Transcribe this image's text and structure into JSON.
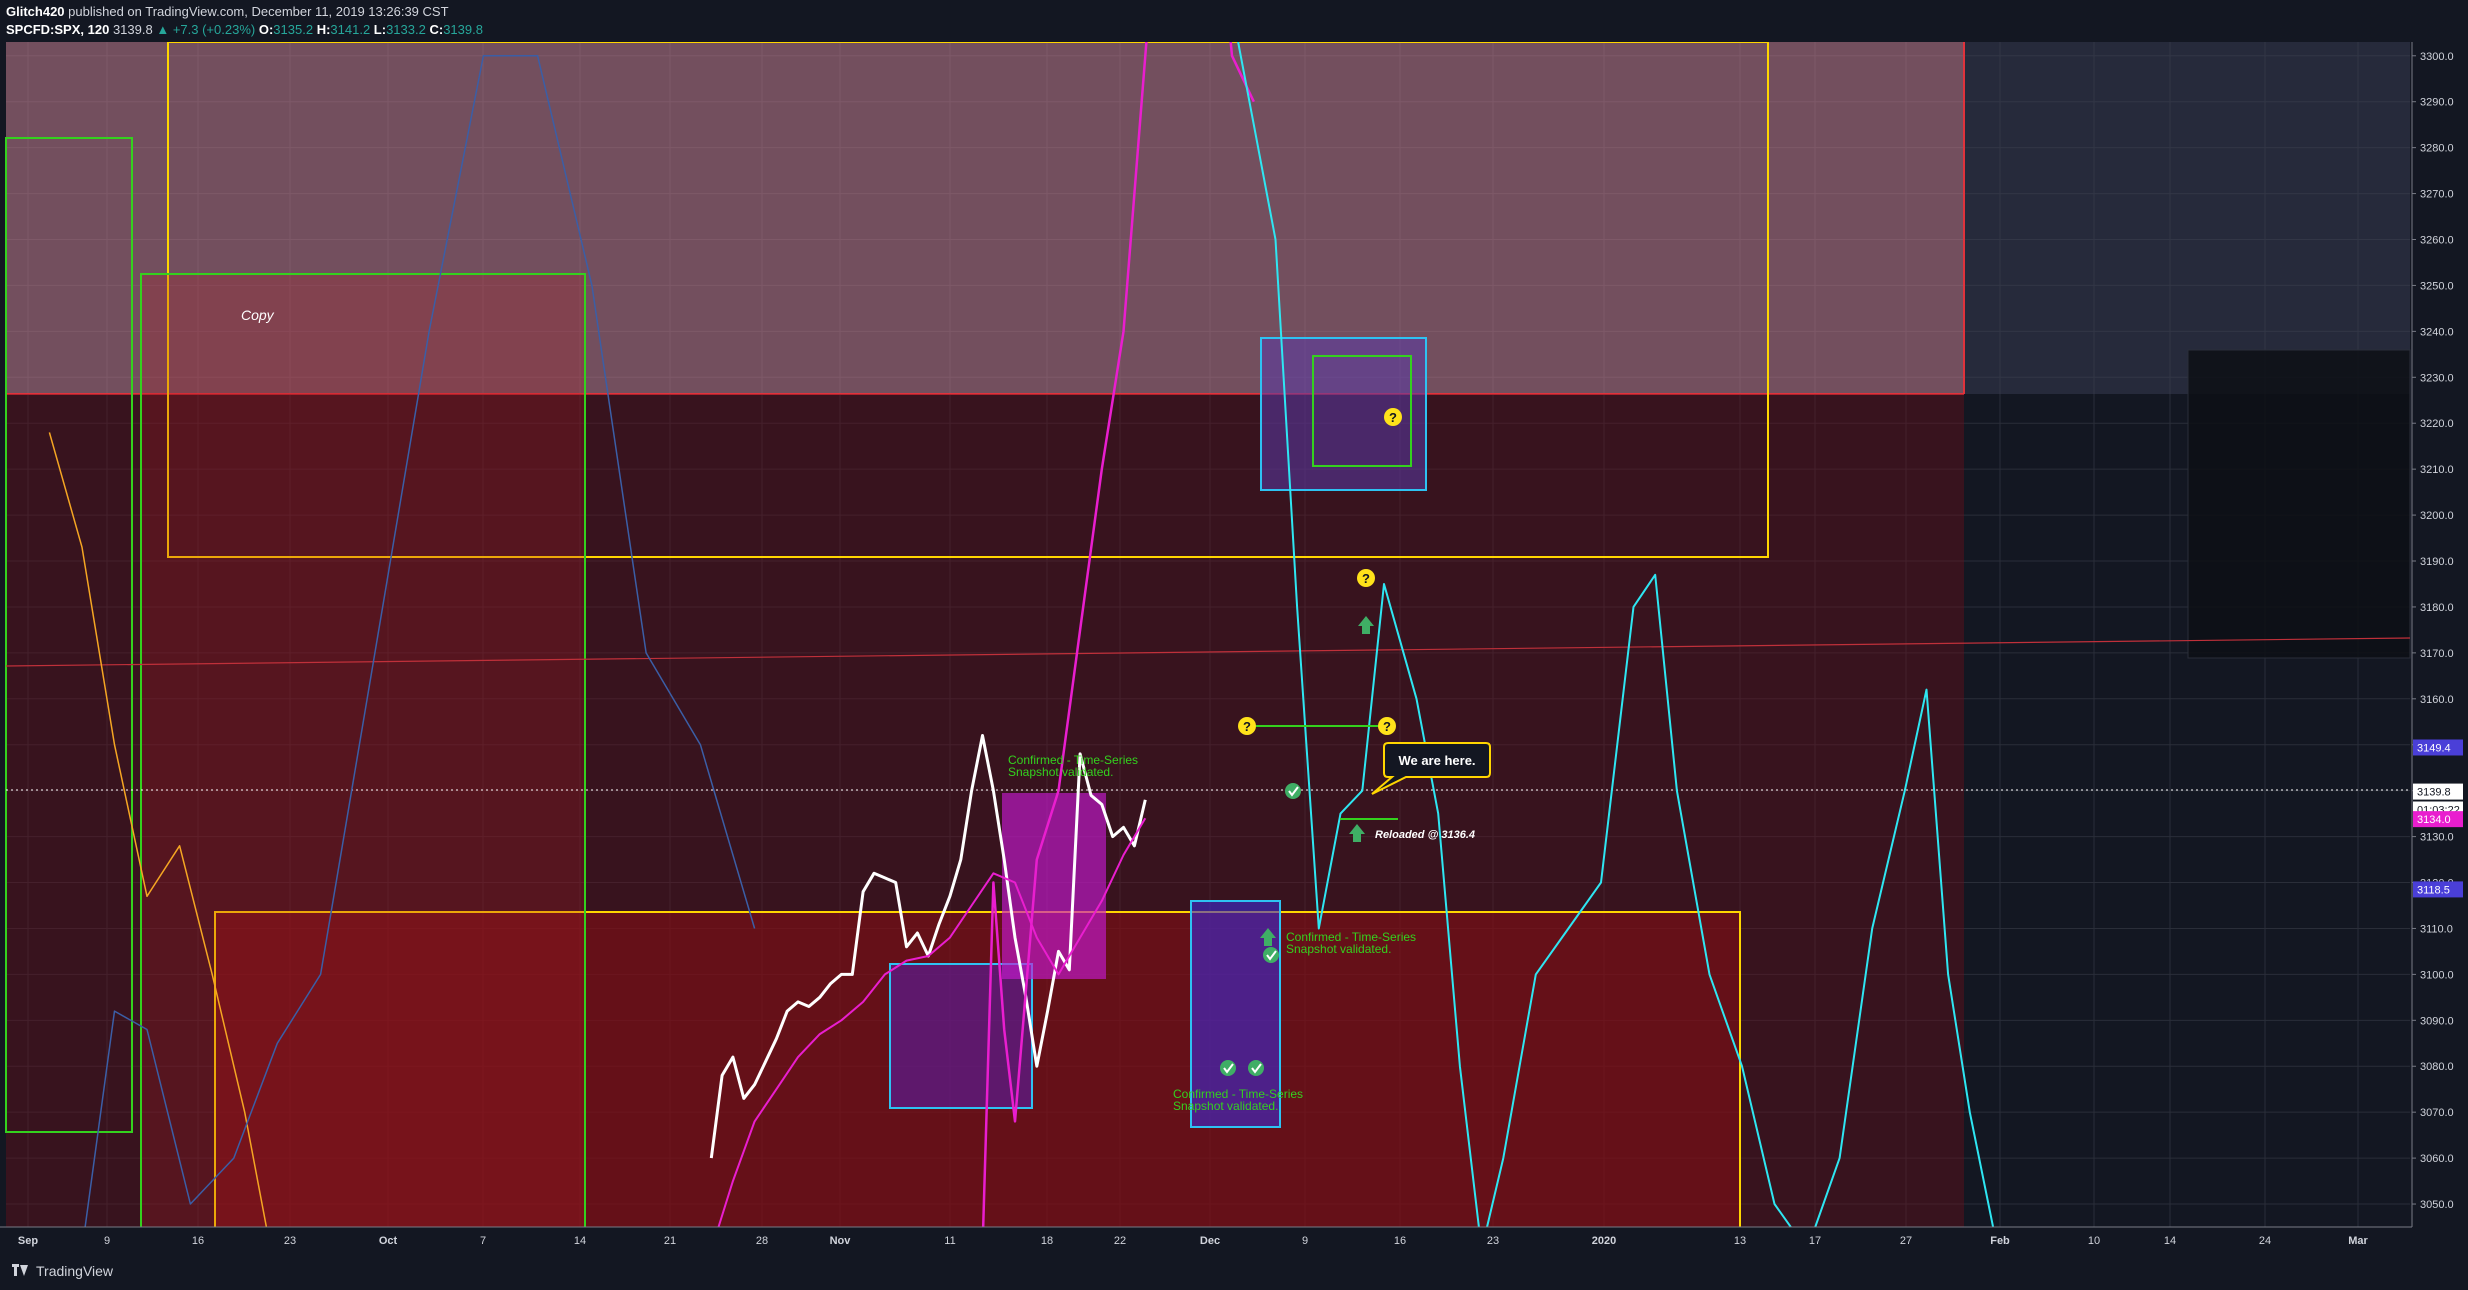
{
  "header": {
    "author": "Glitch420",
    "published": "published on TradingView.com, December 11, 2019 13:26:39 CST",
    "symbol": "SPCFD:SPX, 120",
    "price": "3139.8",
    "change": "+7.3 (+0.23%)",
    "o_label": "O:",
    "o": "3135.2",
    "h_label": "H:",
    "h": "3141.2",
    "l_label": "L:",
    "l": "3133.2",
    "c_label": "C:",
    "c": "3139.8"
  },
  "footer": {
    "brand": "TradingView"
  },
  "colors": {
    "background": "#131722",
    "white_price": "#ffffff",
    "cyan": "#2ee6f2",
    "magenta": "#e91ecf",
    "orange": "#f5a623",
    "blue_line": "#3b5ea6",
    "green_box": "#34d11e",
    "yellow_box": "#ffd600",
    "red_fill": "#b7141f",
    "cyan_box": "#2ec2f2"
  },
  "chart_data": {
    "type": "line",
    "y_axis": {
      "range": [
        3045,
        3303
      ],
      "ticks": [
        3050,
        3060,
        3070,
        3080,
        3090,
        3100,
        3110,
        3120,
        3130,
        3140,
        3150,
        3160,
        3170,
        3180,
        3190,
        3200,
        3210,
        3220,
        3230,
        3240,
        3250,
        3260,
        3270,
        3280,
        3290,
        3300
      ]
    },
    "x_axis": {
      "ticks": [
        "Sep",
        "9",
        "16",
        "23",
        "Oct",
        "7",
        "14",
        "21",
        "28",
        "Nov",
        "11",
        "18",
        "22",
        "Dec",
        "9",
        "16",
        "23",
        "2020",
        "13",
        "17",
        "27",
        "Feb",
        "10",
        "14",
        "24",
        "Mar"
      ]
    },
    "price_labels": [
      {
        "label": "3149.4",
        "value": 3149.4,
        "color": "#4a3fd8"
      },
      {
        "label": "3139.8",
        "value": 3139.8,
        "color": "#ffffff"
      },
      {
        "label": "01:03:22",
        "value": 3135.9,
        "color": "#ffffff"
      },
      {
        "label": "3134.0",
        "value": 3133.8,
        "color": "#e91ecf"
      },
      {
        "label": "3118.5",
        "value": 3118.5,
        "color": "#4a3fd8"
      }
    ],
    "series": [
      {
        "name": "",
        "color": "#ffffff",
        "width": 3,
        "x": [
          "2019-11-01",
          "2019-11-02",
          "2019-11-03",
          "2019-11-04",
          "2019-11-05",
          "2019-11-06",
          "2019-11-07",
          "2019-11-08",
          "2019-11-09",
          "2019-11-10",
          "2019-11-11",
          "2019-11-12",
          "2019-11-13",
          "2019-11-14",
          "2019-11-15",
          "2019-11-16",
          "2019-11-17",
          "2019-11-18",
          "2019-11-19",
          "2019-11-20",
          "2019-11-21",
          "2019-11-22",
          "2019-11-23",
          "2019-11-24",
          "2019-11-25",
          "2019-11-26",
          "2019-11-27",
          "2019-11-28",
          "2019-11-29",
          "2019-11-30",
          "2019-12-01",
          "2019-12-02",
          "2019-12-03",
          "2019-12-04",
          "2019-12-05",
          "2019-12-06",
          "2019-12-07",
          "2019-12-08",
          "2019-12-09",
          "2019-12-10",
          "2019-12-11"
        ],
        "values": [
          3060,
          3078,
          3082,
          3073,
          3076,
          3081,
          3086,
          3092,
          3094,
          3093,
          3095,
          3098,
          3100,
          3100,
          3118,
          3122,
          3121,
          3120,
          3106,
          3109,
          3104,
          3111,
          3117,
          3125,
          3140,
          3152,
          3140,
          3125,
          3108,
          3095,
          3080,
          3092,
          3105,
          3101,
          3148,
          3139,
          3137,
          3130,
          3132,
          3128,
          3138
        ]
      },
      {
        "name": "",
        "color": "#e91ecf",
        "width": 2,
        "x": [
          "2019-11-01",
          "2019-11-03",
          "2019-11-05",
          "2019-11-07",
          "2019-11-09",
          "2019-11-11",
          "2019-11-13",
          "2019-11-15",
          "2019-11-17",
          "2019-11-19",
          "2019-11-21",
          "2019-11-23",
          "2019-11-25",
          "2019-11-27",
          "2019-11-29",
          "2019-12-01",
          "2019-12-03",
          "2019-12-05",
          "2019-12-07",
          "2019-12-09",
          "2019-12-11"
        ],
        "values": [
          3040,
          3055,
          3068,
          3075,
          3082,
          3087,
          3090,
          3094,
          3100,
          3103,
          3104,
          3108,
          3115,
          3122,
          3120,
          3108,
          3100,
          3108,
          3116,
          3126,
          3134
        ]
      },
      {
        "name": "",
        "color": "#e91ecf",
        "width": 2.5,
        "x": [
          "2019-11-26",
          "2019-11-27",
          "2019-11-28",
          "2019-11-29",
          "2019-12-01",
          "2019-12-03",
          "2019-12-05",
          "2019-12-07",
          "2019-12-09",
          "2019-12-11",
          "2019-12-13",
          "2019-12-15",
          "2019-12-17",
          "2019-12-19",
          "2019-12-21"
        ],
        "values": [
          3040,
          3120,
          3088,
          3068,
          3125,
          3140,
          3175,
          3210,
          3240,
          3300,
          3360,
          3400,
          3350,
          3300,
          3290
        ]
      },
      {
        "name": "",
        "color": "#2ee6f2",
        "width": 2,
        "x": [
          "2019-12-19",
          "2019-12-21",
          "2019-12-23",
          "2019-12-25",
          "2019-12-27",
          "2019-12-29",
          "2019-12-31",
          "2020-01-02",
          "2020-01-05",
          "2020-01-07",
          "2020-01-09",
          "2020-01-11",
          "2020-01-13",
          "2020-01-16",
          "2020-01-19",
          "2020-01-22",
          "2020-01-25",
          "2020-01-27",
          "2020-01-29",
          "2020-02-01",
          "2020-02-04",
          "2020-02-07",
          "2020-02-10",
          "2020-02-13",
          "2020-02-16",
          "2020-02-19",
          "2020-02-21",
          "2020-02-23",
          "2020-02-25",
          "2020-02-28"
        ],
        "values": [
          3310,
          3285,
          3260,
          3180,
          3110,
          3135,
          3140,
          3185,
          3160,
          3135,
          3080,
          3040,
          3060,
          3100,
          3110,
          3120,
          3180,
          3187,
          3140,
          3100,
          3080,
          3050,
          3040,
          3060,
          3110,
          3140,
          3162,
          3100,
          3070,
          3035
        ]
      },
      {
        "name": "",
        "color": "#f5a623",
        "width": 1.5,
        "x": [
          "2019-09-01",
          "2019-09-04",
          "2019-09-07",
          "2019-09-10",
          "2019-09-13",
          "2019-09-16",
          "2019-09-19",
          "2019-09-21",
          "2019-09-23"
        ],
        "values": [
          3218,
          3193,
          3150,
          3117,
          3128,
          3100,
          3070,
          3045,
          3030
        ]
      },
      {
        "name": "",
        "color": "#3b5ea6",
        "width": 1.5,
        "x": [
          "2019-09-04",
          "2019-09-07",
          "2019-09-10",
          "2019-09-14",
          "2019-09-18",
          "2019-09-22",
          "2019-09-26",
          "2019-10-01",
          "2019-10-06",
          "2019-10-11",
          "2019-10-16",
          "2019-10-21",
          "2019-10-26",
          "2019-10-31",
          "2019-11-05"
        ],
        "values": [
          3040,
          3092,
          3088,
          3050,
          3060,
          3085,
          3100,
          3170,
          3240,
          3300,
          3300,
          3250,
          3170,
          3150,
          3110
        ]
      }
    ],
    "overlays": [
      "Copy",
      "Confirmed - Time-Series",
      "Snapshot validated.",
      "Confirmed - Time-Series",
      "Snapshot validated.",
      "Confirmed - Time-Series",
      "Snapshot validated.",
      "We are here.",
      "Reloaded @ 3136.4"
    ]
  }
}
